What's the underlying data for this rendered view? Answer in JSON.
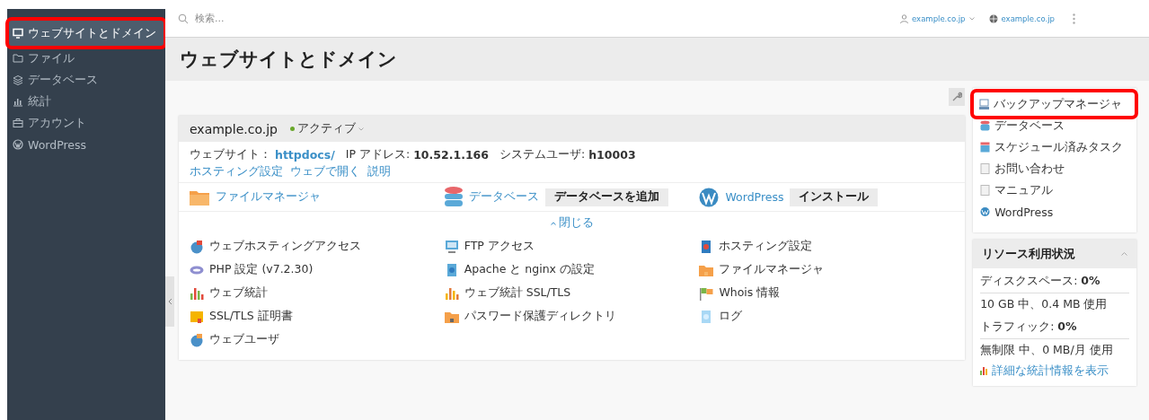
{
  "sidebar": {
    "items": [
      {
        "label": "ウェブサイトとドメイン",
        "selected": true,
        "highlighted": true
      },
      {
        "label": "ファイル",
        "selected": false,
        "highlighted": false
      },
      {
        "label": "データベース",
        "selected": false,
        "highlighted": false
      },
      {
        "label": "統計",
        "selected": false,
        "highlighted": false
      },
      {
        "label": "アカウント",
        "selected": false,
        "highlighted": false
      },
      {
        "label": "WordPress",
        "selected": false,
        "highlighted": false
      }
    ]
  },
  "topbar": {
    "search": {
      "placeholder": "検索..."
    },
    "user": "example.co.jp",
    "domain": "example.co.jp"
  },
  "page_title": "ウェブサイトとドメイン",
  "domain_card": {
    "name": "example.co.jp",
    "status": "アクティブ",
    "info": [
      {
        "label": "ウェブサイト：",
        "value": "httpdocs/",
        "link": true
      },
      {
        "label": "IP アドレス:",
        "value": "10.52.1.166",
        "link": false
      },
      {
        "label": "システムユーザ:",
        "value": "h10003",
        "link": false
      }
    ],
    "links": [
      "ホスティング設定",
      "ウェブで開く",
      "説明"
    ],
    "shortcuts": [
      {
        "label": "ファイルマネージャ"
      },
      {
        "label": "データベース",
        "button": "データベースを追加"
      },
      {
        "label": "WordPress",
        "button": "インストール"
      }
    ],
    "collapse": "閉じる",
    "tools": [
      "ウェブホスティングアクセス",
      "FTP アクセス",
      "ホスティング設定",
      "PHP 設定 (v7.2.30)",
      "Apache と nginx の設定",
      "ファイルマネージャ",
      "ウェブ統計",
      "ウェブ統計 SSL/TLS",
      "Whois 情報",
      "SSL/TLS 証明書",
      "パスワード保護ディレクトリ",
      "ログ",
      "ウェブユーザ"
    ]
  },
  "right_links": [
    {
      "label": "バックアップマネージャ",
      "highlighted": true
    },
    {
      "label": "データベース",
      "highlighted": false
    },
    {
      "label": "スケジュール済みタスク",
      "highlighted": false
    },
    {
      "label": "お問い合わせ",
      "highlighted": false
    },
    {
      "label": "マニュアル",
      "highlighted": false
    },
    {
      "label": "WordPress",
      "highlighted": false
    }
  ],
  "resources": {
    "title": "リソース利用状況",
    "rows": [
      "ディスクスペース: **0%**",
      "10 GB 中、0.4 MB 使用",
      "トラフィック: **0%**",
      "無制限 中、0 MB/月 使用"
    ],
    "link": "詳細な統計情報を表示"
  }
}
